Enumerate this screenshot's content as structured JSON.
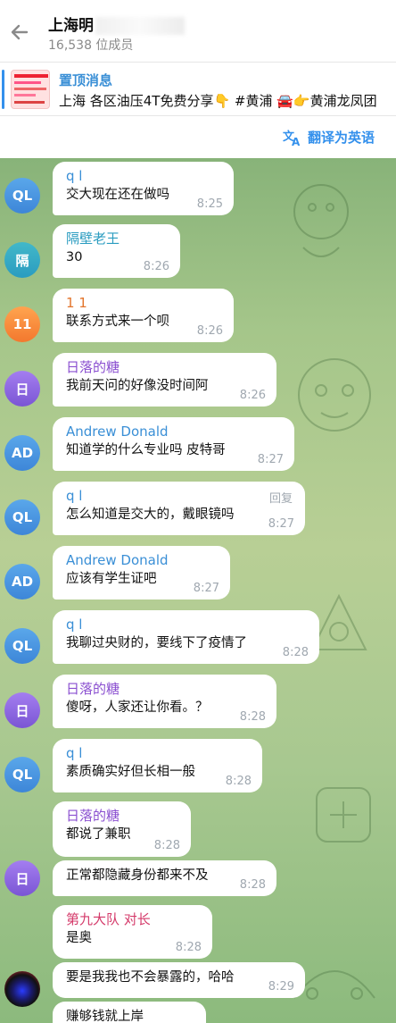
{
  "header": {
    "title": "上海明",
    "subtitle": "16,538 位成员"
  },
  "pinned": {
    "title": "置顶消息",
    "text": "上海 各区油压4T免费分享👇 #黄浦 🚘👉黄浦龙凤团"
  },
  "translate": {
    "label": "翻译为英语"
  },
  "messages": [
    {
      "avatar": "QL",
      "sender": "q l",
      "text": "交大现在还在做吗",
      "time": "8:25"
    },
    {
      "avatar": "隔",
      "sender": "隔壁老王",
      "text": "30",
      "time": "8:26"
    },
    {
      "avatar": "11",
      "sender": "1 1",
      "text": "联系方式来一个呗",
      "time": "8:26"
    },
    {
      "avatar": "日",
      "sender": "日落的糖",
      "text": "我前天问的好像没时间阿",
      "time": "8:26"
    },
    {
      "avatar": "AD",
      "sender": "Andrew Donald",
      "text": "知道学的什么专业吗 皮特哥",
      "time": "8:27"
    },
    {
      "avatar": "QL",
      "sender": "q l",
      "text": "怎么知道是交大的，戴眼镜吗",
      "time": "8:27",
      "reply": "回复"
    },
    {
      "avatar": "AD",
      "sender": "Andrew Donald",
      "text": "应该有学生证吧",
      "time": "8:27"
    },
    {
      "avatar": "QL",
      "sender": "q l",
      "text": "我聊过央财的，要线下了疫情了",
      "time": "8:28"
    },
    {
      "avatar": "日",
      "sender": "日落的糖",
      "text": "傻呀，人家还让你看。？",
      "time": "8:28"
    },
    {
      "avatar": "QL",
      "sender": "q l",
      "text": "素质确实好但长相一般",
      "time": "8:28"
    },
    {
      "sender": "日落的糖",
      "text": "都说了兼职",
      "time": "8:28"
    },
    {
      "avatar": "日",
      "text": "正常都隐藏身份都来不及",
      "time": "8:28"
    },
    {
      "sender": "第九大队 对长",
      "text": "是奥",
      "time": "8:28"
    },
    {
      "text": "要是我我也不会暴露的，哈哈",
      "time": "8:29"
    },
    {
      "text": "赚够钱就上岸"
    }
  ],
  "colors": {
    "accent": "#3390ec",
    "sender_ql": "#3a8fd6",
    "sender_ge": "#2a9cc0",
    "sender_11": "#e3752c",
    "sender_ri": "#8a4fd0",
    "sender_ad": "#3a8fd6",
    "sender_dj": "#d43a6a"
  }
}
